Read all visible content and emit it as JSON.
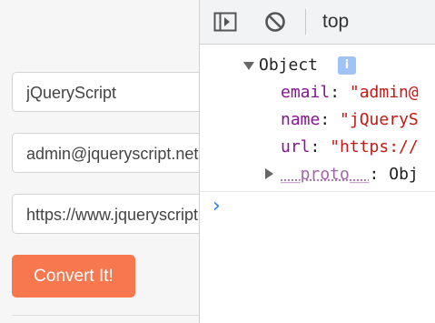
{
  "form": {
    "name_value": "jQueryScript",
    "email_value": "admin@jqueryscript.net",
    "url_value": "https://www.jqueryscript.net",
    "convert_label": "Convert It!"
  },
  "devtools": {
    "context_label": "top",
    "object_label": "Object",
    "info_badge": "i",
    "props": [
      {
        "key": "email",
        "value": "\"admin@"
      },
      {
        "key": "name",
        "value": "\"jQueryS"
      },
      {
        "key": "url",
        "value": "\"https://"
      }
    ],
    "proto_key": "__proto__",
    "proto_value": "Obj",
    "prompt_symbol": "›"
  },
  "colors": {
    "accent": "#f7784f",
    "string": "#c41a16",
    "key": "#881391",
    "prompt": "#2f7be6"
  }
}
